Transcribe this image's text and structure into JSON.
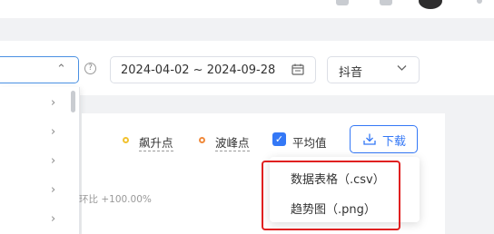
{
  "help_icon_glyph": "?",
  "date_range": {
    "value": "2024-04-02 ~ 2024-09-28"
  },
  "platform_select": {
    "value": "抖音"
  },
  "legend": {
    "surge_label": "飙升点",
    "surge_color": "#f2c230",
    "peak_label": "波峰点",
    "peak_color": "#f08a3c",
    "average_label": "平均值",
    "average_checked": true
  },
  "download_button": {
    "label": "下载"
  },
  "download_menu": {
    "items": [
      "数据表格（.csv）",
      "趋势图（.png）"
    ]
  },
  "change_text": "环比 +100.00%",
  "colors": {
    "accent": "#3478f6",
    "highlight": "#e02020"
  }
}
